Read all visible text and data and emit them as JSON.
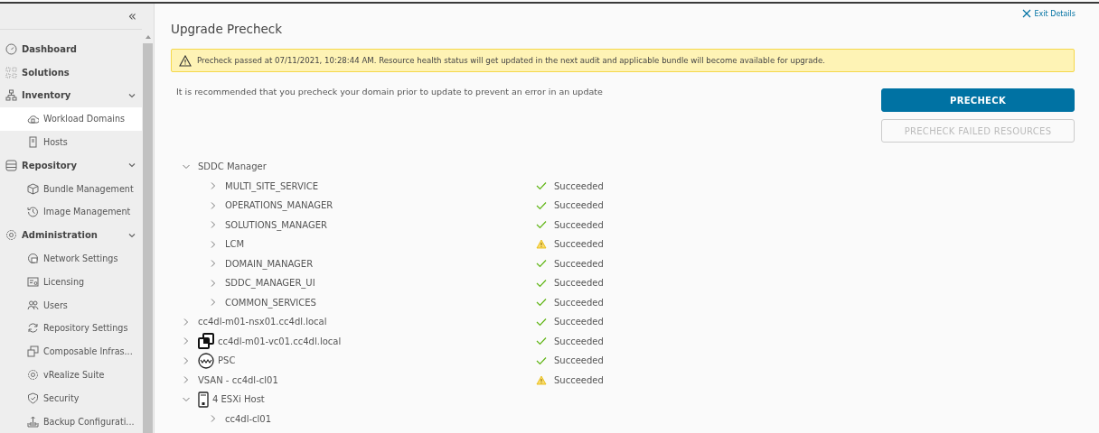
{
  "sidebar": {
    "collapse": "«",
    "items": [
      {
        "label": "Dashboard",
        "kind": "group",
        "selected": false
      },
      {
        "label": "Solutions",
        "kind": "group",
        "selected": false
      },
      {
        "label": "Inventory",
        "kind": "group",
        "selected": false,
        "expanded": true,
        "children": [
          {
            "label": "Workload Domains",
            "kind": "item",
            "selected": true
          },
          {
            "label": "Hosts",
            "kind": "item",
            "selected": false
          }
        ]
      },
      {
        "label": "Repository",
        "kind": "group",
        "selected": false,
        "expanded": true,
        "children": [
          {
            "label": "Bundle Management",
            "kind": "item",
            "selected": false
          },
          {
            "label": "Image Management",
            "kind": "item",
            "selected": false
          }
        ]
      },
      {
        "label": "Administration",
        "kind": "group",
        "selected": false,
        "expanded": true,
        "children": [
          {
            "label": "Network Settings",
            "kind": "item",
            "selected": false
          },
          {
            "label": "Licensing",
            "kind": "item",
            "selected": false
          },
          {
            "label": "Users",
            "kind": "item",
            "selected": false
          },
          {
            "label": "Repository Settings",
            "kind": "item",
            "selected": false
          },
          {
            "label": "Composable Infras...",
            "kind": "item",
            "selected": false
          },
          {
            "label": "vRealize Suite",
            "kind": "item",
            "selected": false
          },
          {
            "label": "Security",
            "kind": "item",
            "selected": false
          },
          {
            "label": "Backup Configurati...",
            "kind": "item",
            "selected": false
          }
        ]
      }
    ]
  },
  "exit_link": "Exit Details",
  "title": "Upgrade Precheck",
  "alert": "Precheck passed at 07/11/2021, 10:28:44 AM. Resource health status will get updated in the next audit and applicable bundle will become available for upgrade.",
  "hint": "It is recommended that you precheck your domain prior to update to prevent an error in an update",
  "buttons": [
    {
      "label": "PRECHECK",
      "disabled": false
    },
    {
      "label": "PRECHECK FAILED RESOURCES",
      "disabled": true
    }
  ],
  "tree": [
    {
      "label": "SDDC Manager",
      "kind": "plain",
      "expanded": true,
      "children": [
        {
          "label": "MULTI_SITE_SERVICE",
          "kind": "plain",
          "expanded": false,
          "status": {
            "text": "Succeeded",
            "kind": "ok"
          }
        },
        {
          "label": "OPERATIONS_MANAGER",
          "kind": "plain",
          "expanded": false,
          "status": {
            "text": "Succeeded",
            "kind": "ok"
          }
        },
        {
          "label": "SOLUTIONS_MANAGER",
          "kind": "plain",
          "expanded": false,
          "status": {
            "text": "Succeeded",
            "kind": "ok"
          }
        },
        {
          "label": "LCM",
          "kind": "plain",
          "expanded": false,
          "status": {
            "text": "Succeeded",
            "kind": "warn"
          }
        },
        {
          "label": "DOMAIN_MANAGER",
          "kind": "plain",
          "expanded": false,
          "status": {
            "text": "Succeeded",
            "kind": "ok"
          }
        },
        {
          "label": "SDDC_MANAGER_UI",
          "kind": "plain",
          "expanded": false,
          "status": {
            "text": "Succeeded",
            "kind": "ok"
          }
        },
        {
          "label": "COMMON_SERVICES",
          "kind": "plain",
          "expanded": false,
          "status": {
            "text": "Succeeded",
            "kind": "ok"
          }
        }
      ]
    },
    {
      "label": "cc4dl-m01-nsx01.cc4dl.local",
      "kind": "plain",
      "expanded": false,
      "status": {
        "text": "Succeeded",
        "kind": "ok"
      }
    },
    {
      "label": "cc4dl-m01-vc01.cc4dl.local",
      "kind": "vcenter",
      "expanded": false,
      "status": {
        "text": "Succeeded",
        "kind": "ok"
      }
    },
    {
      "label": "PSC",
      "kind": "psc",
      "expanded": false,
      "status": {
        "text": "Succeeded",
        "kind": "ok"
      }
    },
    {
      "label": "VSAN - cc4dl-cl01",
      "kind": "plain",
      "expanded": false,
      "status": {
        "text": "Succeeded",
        "kind": "warn"
      }
    },
    {
      "label": "4 ESXi Host",
      "kind": "host",
      "expanded": true,
      "children": [
        {
          "label": "cc4dl-cl01",
          "kind": "plain",
          "expanded": false
        }
      ]
    }
  ]
}
